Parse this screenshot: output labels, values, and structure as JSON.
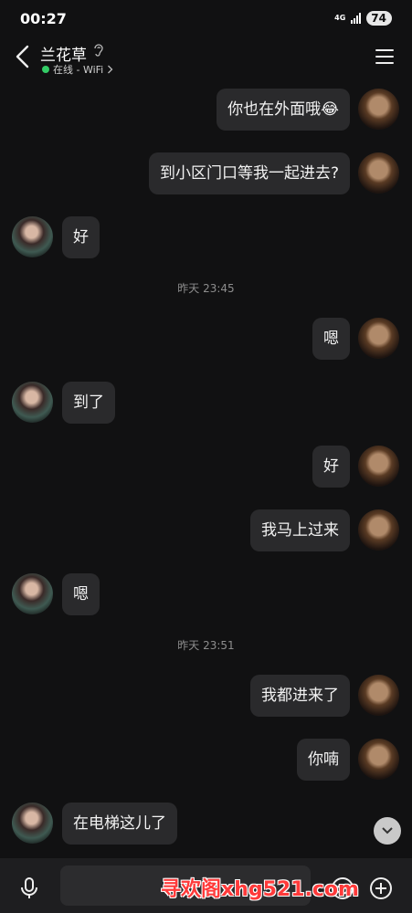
{
  "status_bar": {
    "time": "00:27",
    "network": "4G",
    "battery": "74"
  },
  "header": {
    "contact_name": "兰花草",
    "presence": "在线 - WiFi",
    "presence_color": "#33cc66"
  },
  "messages": [
    {
      "side": "right",
      "text": "你也在外面哦😂"
    },
    {
      "side": "right",
      "text": "到小区门口等我一起进去?"
    },
    {
      "side": "left",
      "text": "好"
    },
    {
      "type": "time",
      "text": "昨天 23:45"
    },
    {
      "side": "right",
      "text": "嗯"
    },
    {
      "side": "left",
      "text": "到了"
    },
    {
      "side": "right",
      "text": "好"
    },
    {
      "side": "right",
      "text": "我马上过来"
    },
    {
      "side": "left",
      "text": "嗯"
    },
    {
      "type": "time",
      "text": "昨天 23:51"
    },
    {
      "side": "right",
      "text": "我都进来了"
    },
    {
      "side": "right",
      "text": "你喃"
    },
    {
      "side": "left",
      "text": "在电梯这儿了"
    }
  ],
  "watermark": "寻欢阁xhg521.com",
  "colors": {
    "background": "#111112",
    "bubble": "#2a2a2c",
    "timestamp": "#8d8d8d",
    "watermark": "#ff3a3a"
  }
}
